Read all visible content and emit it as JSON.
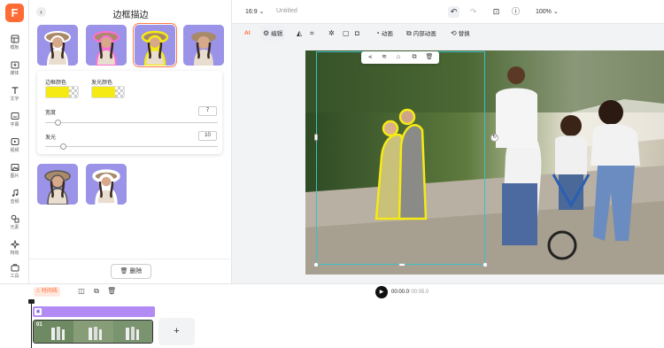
{
  "app": {
    "logo_letter": "F",
    "accent": "#ff6b35"
  },
  "rail": {
    "items": [
      {
        "label": "模板",
        "icon": "template-icon"
      },
      {
        "label": "媒体",
        "icon": "media-icon"
      },
      {
        "label": "文字",
        "icon": "text-icon"
      },
      {
        "label": "字幕",
        "icon": "subtitle-icon"
      },
      {
        "label": "视频",
        "icon": "video-icon"
      },
      {
        "label": "图片",
        "icon": "image-icon"
      },
      {
        "label": "音频",
        "icon": "audio-icon"
      },
      {
        "label": "元素",
        "icon": "elements-icon"
      },
      {
        "label": "特效",
        "icon": "effects-icon"
      },
      {
        "label": "工具",
        "icon": "tools-icon"
      }
    ]
  },
  "panel": {
    "title": "边框描边",
    "border_color_label": "边框颜色",
    "glow_color_label": "发光颜色",
    "border_color": "#f5ea14",
    "width_label": "宽度",
    "width_value": "7",
    "width_level": 0.07,
    "glow_label": "发光",
    "glow_value": "10",
    "glow_level": 0.1,
    "delete_label": "删除",
    "presets": [
      {
        "name": "white-outline",
        "stroke": "#ffffff",
        "selected": false
      },
      {
        "name": "pink-glow",
        "stroke": "#ff6fd6",
        "selected": false
      },
      {
        "name": "yellow-outline",
        "stroke": "#f5ea14",
        "selected": true
      },
      {
        "name": "plain",
        "stroke": "none",
        "selected": false
      },
      {
        "name": "dark-outline",
        "stroke": "#444444",
        "selected": false
      },
      {
        "name": "white-thick",
        "stroke": "#ffffff",
        "selected": false
      }
    ]
  },
  "topbar": {
    "ratio": "16:9",
    "title": "Untitled",
    "zoom": "100%"
  },
  "toolbar": {
    "ai_label": "AI",
    "edit_label": "编辑",
    "animate_label": "动画",
    "inner_animate_label": "内部动画",
    "replace_label": "替换"
  },
  "timeline": {
    "timeline_label": "时间线",
    "current_time": "00:00.0",
    "total_time": "/ 00:05.0",
    "clip_number": "01",
    "add_label": "+"
  }
}
